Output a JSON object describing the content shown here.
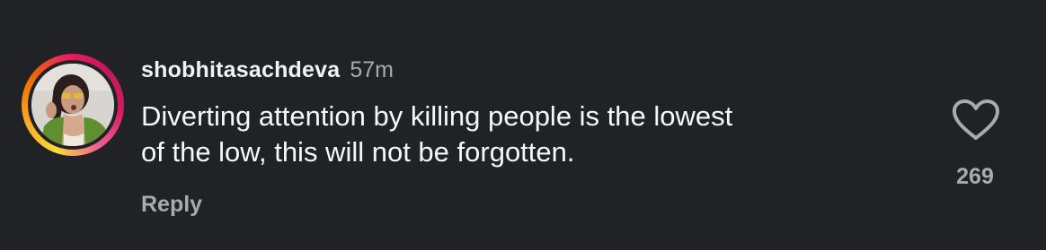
{
  "comment": {
    "username": "shobhitasachdeva",
    "timestamp": "57m",
    "text_line1": "Diverting attention by killing people is the lowest",
    "text_line2": "of the low, this will not be forgotten.",
    "reply_label": "Reply",
    "like_count": "269",
    "like_icon": "heart-outline-icon",
    "avatar_icon": "user-avatar-photo"
  },
  "colors": {
    "background": "#212226",
    "primary_text": "#f5f5f5",
    "secondary_text": "#a9aab0",
    "story_ring": [
      "#fdd835",
      "#ef6c00",
      "#e91e63"
    ]
  }
}
